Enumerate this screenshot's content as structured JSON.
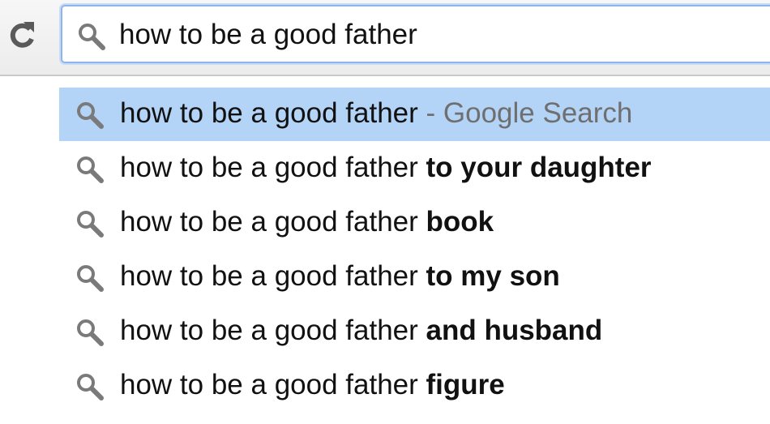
{
  "omnibox": {
    "value": "how to be a good father"
  },
  "suggestions": [
    {
      "prefix": "how to be a good father",
      "completion": "",
      "hint": " - Google Search",
      "selected": true
    },
    {
      "prefix": "how to be a good father ",
      "completion": "to your daughter",
      "hint": ""
    },
    {
      "prefix": "how to be a good father ",
      "completion": "book",
      "hint": ""
    },
    {
      "prefix": "how to be a good father ",
      "completion": "to my son",
      "hint": ""
    },
    {
      "prefix": "how to be a good father ",
      "completion": "and husband",
      "hint": ""
    },
    {
      "prefix": "how to be a good father ",
      "completion": "figure",
      "hint": ""
    }
  ],
  "icons": {
    "reload": "reload-icon",
    "search": "search-icon"
  },
  "colors": {
    "selected_row": "#b3d3f7",
    "omnibox_focus_border": "#8fb4ec",
    "hint_text": "#6f6f6f"
  }
}
